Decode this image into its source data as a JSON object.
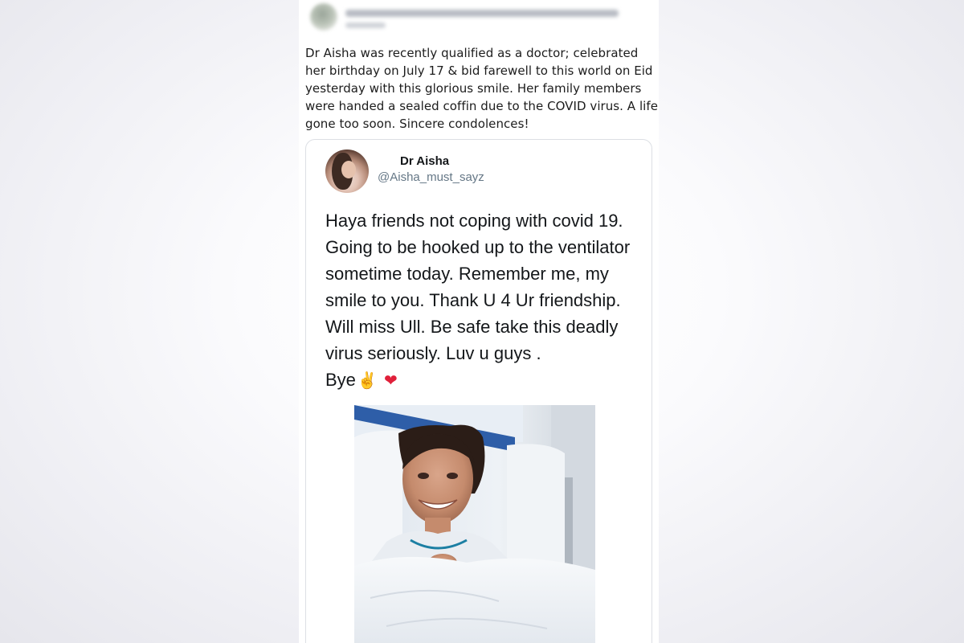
{
  "post": {
    "text": "Dr Aisha was recently qualified as a doctor; celebrated her birthday on July 17 & bid farewell to this world on Eid yesterday with this glorious smile. Her family members were handed a sealed coffin due to the COVID virus. A life gone too soon. Sincere condolences!"
  },
  "tweet": {
    "name": "Dr Aisha",
    "handle": "@Aisha_must_sayz",
    "body": "Haya friends not coping with covid 19. Going to be hooked up to the ventilator sometime today. Remember me, my smile to you.  Thank U 4 Ur friendship.  Will miss Ull. Be safe take this deadly virus seriously.  Luv u guys .\nBye",
    "emoji_1": "✌",
    "emoji_2": "❤",
    "emoji_1_color": "#e8b130",
    "emoji_2_color": "#e0203a"
  },
  "icons": {
    "poster_avatar": "blurred-avatar",
    "tweet_avatar": "profile-photo",
    "tweet_photo": "hospital-bed-photo"
  },
  "colors": {
    "name": "#14171a",
    "handle": "#657786",
    "card_border": "#dcdfe4"
  }
}
